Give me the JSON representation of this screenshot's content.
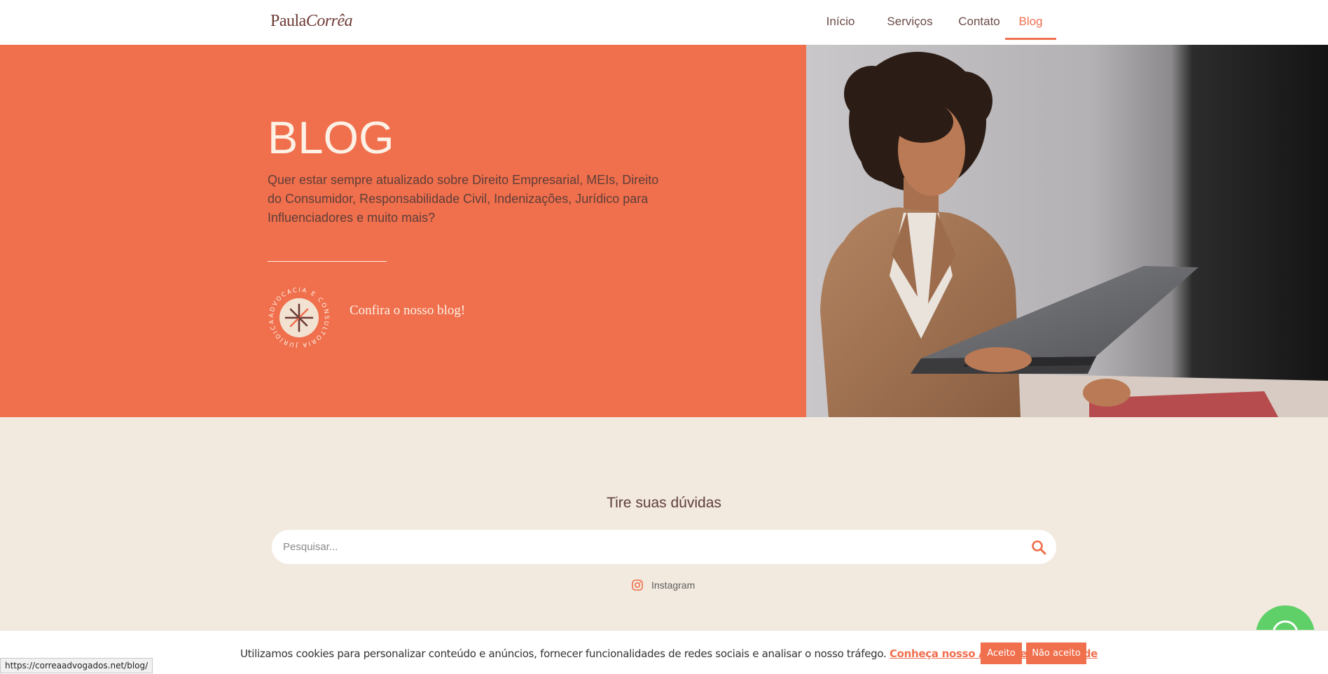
{
  "header": {
    "logo_first": "Paula",
    "logo_last": "Corrêa",
    "nav": [
      {
        "label": "Início",
        "active": false
      },
      {
        "label": "Serviços",
        "active": false
      },
      {
        "label": "Contato",
        "active": false
      },
      {
        "label": "Blog",
        "active": true
      }
    ]
  },
  "hero": {
    "title": "BLOG",
    "description": "Quer estar sempre atualizado sobre Direito Empresarial, MEIs, Direito do Consumidor, Responsabilidade Civil, Indenizações, Jurídico para Influenciadores e muito mais?",
    "seal_text": "ADVOCACIA E CONSULTORIA JURÍDICA",
    "cta": "Confira o nosso blog!"
  },
  "faq": {
    "title": "Tire suas dúvidas",
    "search_placeholder": "Pesquisar..."
  },
  "social": {
    "instagram": "Instagram"
  },
  "cookie": {
    "text": "Utilizamos cookies para personalizar conteúdo e anúncios, fornecer funcionalidades de redes sociais e analisar o nosso tráfego.",
    "link": "Conheça nosso Aviso de Privacidade",
    "accept": "Aceito",
    "reject": "Não aceito"
  },
  "status_bar": {
    "url": "https://correaadvogados.net/blog/"
  },
  "colors": {
    "accent": "#f06f4c",
    "cream": "#f2e9df",
    "brown": "#6e3a35",
    "whatsapp": "#5fd068"
  }
}
